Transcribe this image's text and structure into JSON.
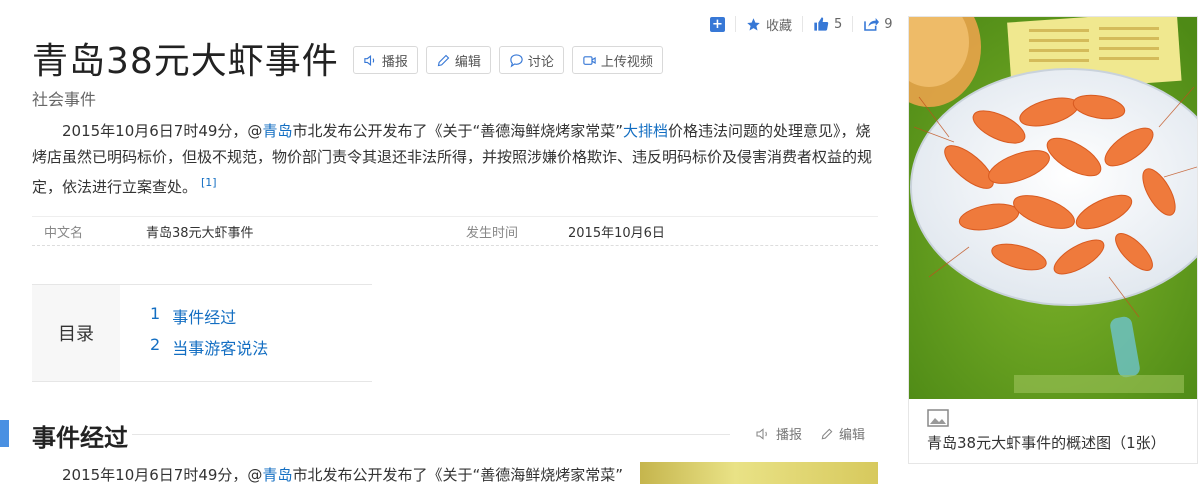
{
  "header": {
    "title": "青岛38元大虾事件",
    "subtitle": "社会事件",
    "buttons": {
      "broadcast": "播报",
      "edit": "编辑",
      "discuss": "讨论",
      "upload": "上传视频"
    },
    "actions": {
      "favorite": "收藏",
      "likes": "5",
      "shares": "9"
    }
  },
  "summary": {
    "p1": "2015年10月6日7时49分，@",
    "link1": "青岛",
    "p2": "市北发布公开发布了《关于“善德海鲜烧烤家常菜”",
    "link2": "大排档",
    "p3": "价格违法问题的处理意见》，烧烤店虽然已明码标价，但极不规范，物价部门责令其退还非法所得，并按照涉嫌价格欺诈、违反明码标价及侵害消费者权益的规定，依法进行立案查处。",
    "ref": "[1]"
  },
  "infobox": {
    "items": [
      {
        "key": "中文名",
        "value": "青岛38元大虾事件"
      },
      {
        "key": "发生时间",
        "value": "2015年10月6日"
      }
    ]
  },
  "toc": {
    "heading": "目录",
    "items": [
      {
        "num": "1",
        "label": "事件经过"
      },
      {
        "num": "2",
        "label": "当事游客说法"
      }
    ]
  },
  "section": {
    "title": "事件经过",
    "broadcast": "播报",
    "edit": "编辑",
    "p1": "2015年10月6日7时49分，@",
    "link1": "青岛",
    "p2": "市北发布公开发布了《关于“善德海鲜烧烤家常菜”"
  },
  "sidebar": {
    "caption": "青岛38元大虾事件的概述图（1张）"
  },
  "colors": {
    "link": "#136ec2",
    "accent": "#4a90e2",
    "icon_blue": "#3778d6"
  }
}
